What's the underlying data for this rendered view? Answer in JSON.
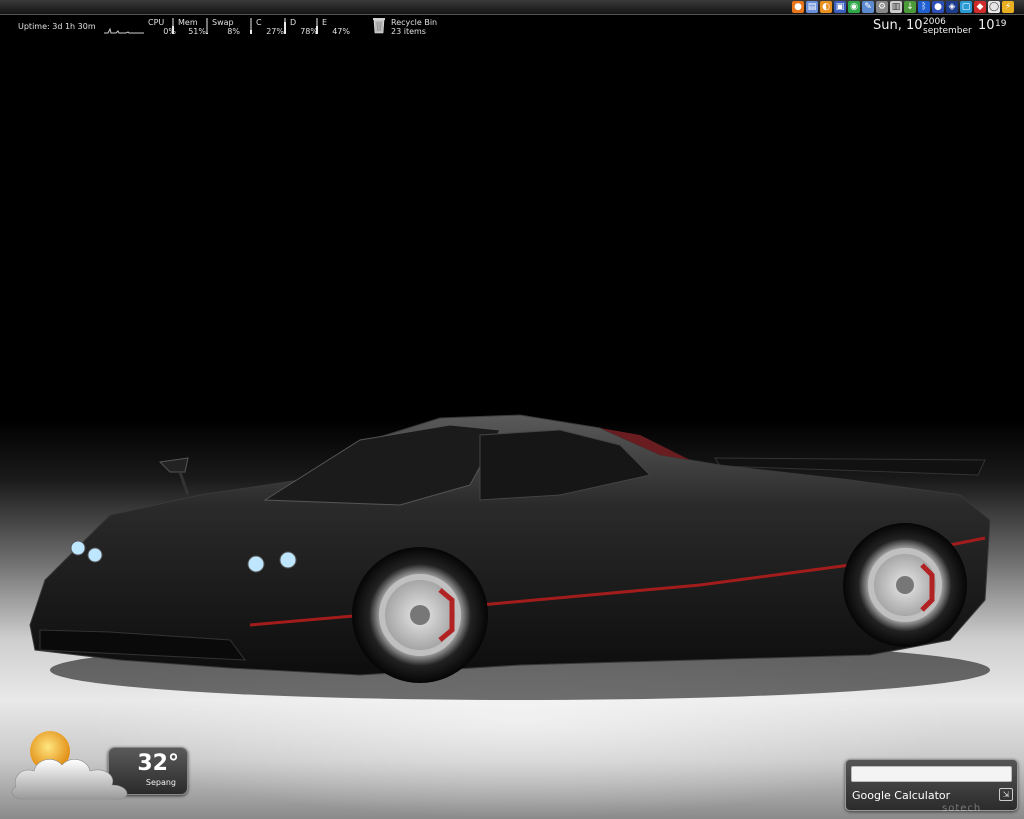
{
  "system_monitor": {
    "uptime": "Uptime: 3d 1h 30m",
    "meters": [
      {
        "label": "CPU",
        "value": "0%",
        "level": 0.0
      },
      {
        "label": "Mem",
        "value": "51%",
        "level": 0.51
      },
      {
        "label": "Swap",
        "value": "8%",
        "level": 0.08
      },
      {
        "label": "C",
        "value": "27%",
        "level": 0.27
      },
      {
        "label": "D",
        "value": "78%",
        "level": 0.78
      },
      {
        "label": "E",
        "value": "47%",
        "level": 0.47
      }
    ]
  },
  "recycle_bin": {
    "label": "Recycle Bin",
    "count": "23 items",
    "icon": "recycle-bin-icon"
  },
  "clock": {
    "day": "Sun, 10",
    "year": "2006",
    "month": "september",
    "hour": "10",
    "minute": "19"
  },
  "tray_icons": [
    {
      "name": "firefox-icon",
      "color": "#e8751a",
      "glyph": "●"
    },
    {
      "name": "notes-icon",
      "color": "#6a8fd8",
      "glyph": "▤"
    },
    {
      "name": "media-player-icon",
      "color": "#e89020",
      "glyph": "◐"
    },
    {
      "name": "save-icon",
      "color": "#3a5fbf",
      "glyph": "▣"
    },
    {
      "name": "network-icon",
      "color": "#2fa84a",
      "glyph": "◉"
    },
    {
      "name": "editor-icon",
      "color": "#5b8ad0",
      "glyph": "✎"
    },
    {
      "name": "settings-icon",
      "color": "#888888",
      "glyph": "⚙"
    },
    {
      "name": "clipboard-icon",
      "color": "#cccccc",
      "glyph": "▥"
    },
    {
      "name": "download-icon",
      "color": "#4b9b3a",
      "glyph": "↓"
    },
    {
      "name": "bluetooth-icon",
      "color": "#1f5fd0",
      "glyph": "ᛒ"
    },
    {
      "name": "globe-icon",
      "color": "#2c4fb8",
      "glyph": "●"
    },
    {
      "name": "shield-icon",
      "color": "#1d3c8f",
      "glyph": "◈"
    },
    {
      "name": "monitor-icon",
      "color": "#2a9ad4",
      "glyph": "▢"
    },
    {
      "name": "antivirus-icon",
      "color": "#d02a2a",
      "glyph": "◆"
    },
    {
      "name": "chat-icon",
      "color": "#e6e6e6",
      "glyph": "◯"
    },
    {
      "name": "power-icon",
      "color": "#e8b020",
      "glyph": "⚡"
    }
  ],
  "weather": {
    "temperature": "32°",
    "city": "Sepang",
    "icon": "partly-cloudy-icon"
  },
  "google_calculator": {
    "title": "Google Calculator",
    "input_value": "",
    "input_placeholder": ""
  },
  "watermark": "sotech"
}
